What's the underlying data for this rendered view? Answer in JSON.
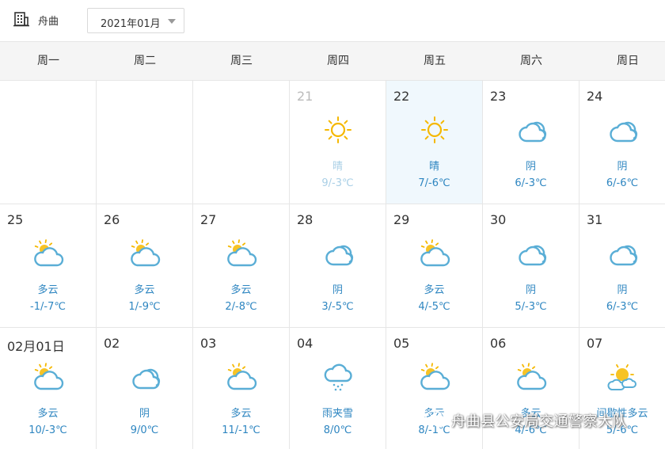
{
  "header": {
    "city": "舟曲",
    "month": "2021年01月"
  },
  "weekdays": [
    "周一",
    "周二",
    "周三",
    "周四",
    "周五",
    "周六",
    "周日"
  ],
  "rows": [
    [
      {
        "blank": true
      },
      {
        "blank": true
      },
      {
        "blank": true
      },
      {
        "day": "21",
        "icon": "sunny-icon",
        "cond": "晴",
        "temp": "9/-3℃",
        "past": true
      },
      {
        "day": "22",
        "icon": "sunny-icon",
        "cond": "晴",
        "temp": "7/-6℃",
        "today": true
      },
      {
        "day": "23",
        "icon": "overcast-icon",
        "cond": "阴",
        "temp": "6/-3℃"
      },
      {
        "day": "24",
        "icon": "overcast-icon",
        "cond": "阴",
        "temp": "6/-6℃"
      }
    ],
    [
      {
        "day": "25",
        "icon": "partly-cloudy-icon",
        "cond": "多云",
        "temp": "-1/-7℃"
      },
      {
        "day": "26",
        "icon": "partly-cloudy-icon",
        "cond": "多云",
        "temp": "1/-9℃"
      },
      {
        "day": "27",
        "icon": "partly-cloudy-icon",
        "cond": "多云",
        "temp": "2/-8℃"
      },
      {
        "day": "28",
        "icon": "overcast-icon",
        "cond": "阴",
        "temp": "3/-5℃"
      },
      {
        "day": "29",
        "icon": "partly-cloudy-icon",
        "cond": "多云",
        "temp": "4/-5℃"
      },
      {
        "day": "30",
        "icon": "overcast-icon",
        "cond": "阴",
        "temp": "5/-3℃"
      },
      {
        "day": "31",
        "icon": "overcast-icon",
        "cond": "阴",
        "temp": "6/-3℃"
      }
    ],
    [
      {
        "day": "02月01日",
        "icon": "partly-cloudy-icon",
        "cond": "多云",
        "temp": "10/-3℃"
      },
      {
        "day": "02",
        "icon": "overcast-icon",
        "cond": "阴",
        "temp": "9/0℃"
      },
      {
        "day": "03",
        "icon": "partly-cloudy-icon",
        "cond": "多云",
        "temp": "11/-1℃"
      },
      {
        "day": "04",
        "icon": "sleet-icon",
        "cond": "雨夹雪",
        "temp": "8/0℃"
      },
      {
        "day": "05",
        "icon": "partly-cloudy-icon",
        "cond": "多云",
        "temp": "8/-1℃"
      },
      {
        "day": "06",
        "icon": "partly-cloudy-icon",
        "cond": "多云",
        "temp": "4/-6℃"
      },
      {
        "day": "07",
        "icon": "intermittent-cloudy-icon",
        "cond": "间歇性多云",
        "temp": "5/-6℃"
      }
    ]
  ],
  "watermark": "舟曲县公安局交通警察大队",
  "colors": {
    "accent": "#2e86c1",
    "sun": "#f5b800",
    "cloud": "#5aaed6",
    "today_bg": "#f0f8fd"
  }
}
